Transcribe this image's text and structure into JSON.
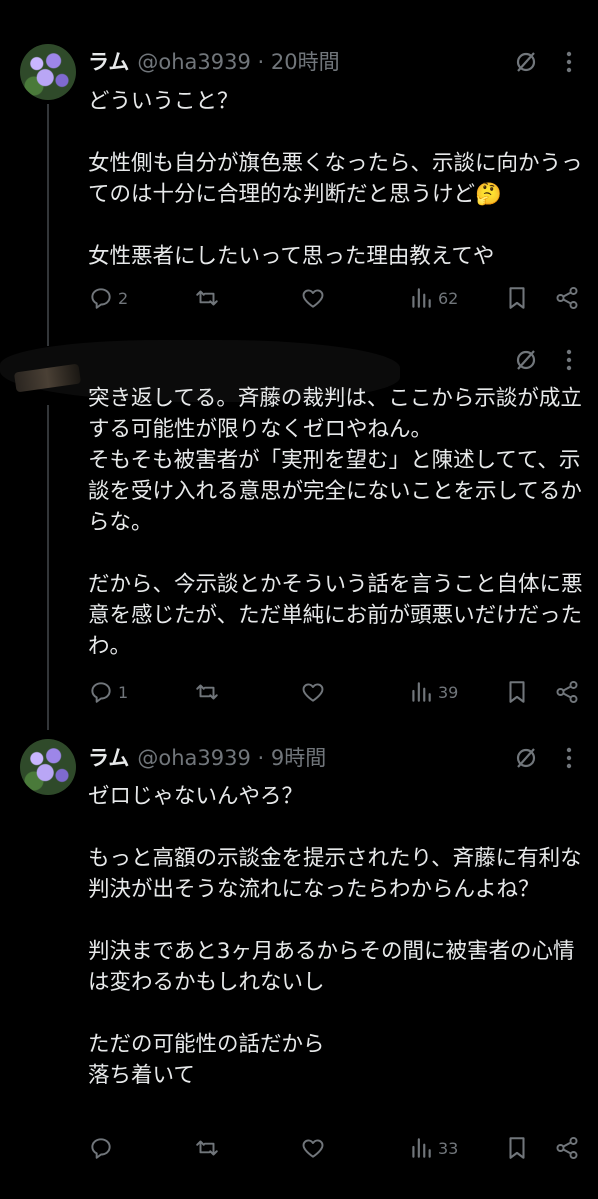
{
  "tweets": [
    {
      "name": "ラム",
      "handle_time": "@oha3939 · 20時間",
      "text": "どういうこと？\n\n女性側も自分が旗色悪くなったら、示談に向かうってのは十分に合理的な判断だと思うけど🤔\n\n女性悪者にしたいって思った理由教えてや",
      "replies": "2",
      "retweets": "",
      "likes": "",
      "views": "62"
    },
    {
      "name": "",
      "handle_time": "",
      "text": "突き返してる。斉藤の裁判は、ここから示談が成立する可能性が限りなくゼロやねん。\nそもそも被害者が「実刑を望む」と陳述してて、示談を受け入れる意思が完全にないことを示してるからな。\n\nだから、今示談とかそういう話を言うこと自体に悪意を感じたが、ただ単純にお前が頭悪いだけだったわ。",
      "replies": "1",
      "retweets": "",
      "likes": "",
      "views": "39"
    },
    {
      "name": "ラム",
      "handle_time": "@oha3939 · 9時間",
      "text": "ゼロじゃないんやろ？\n\nもっと高額の示談金を提示されたり、斉藤に有利な判決が出そうな流れになったらわからんよね？\n\n判決まであと3ヶ月あるからその間に被害者の心情は変わるかもしれないし\n\nただの可能性の話だから\n落ち着いて",
      "replies": "",
      "retweets": "",
      "likes": "",
      "views": "33"
    }
  ],
  "colors": {
    "background": "#000000",
    "text": "#e7e9ea",
    "secondary": "#71767b",
    "thread_line": "#333639"
  },
  "icons": [
    "reply-icon",
    "retweet-icon",
    "like-icon",
    "views-icon",
    "bookmark-icon",
    "share-icon",
    "grok-icon",
    "more-icon"
  ]
}
